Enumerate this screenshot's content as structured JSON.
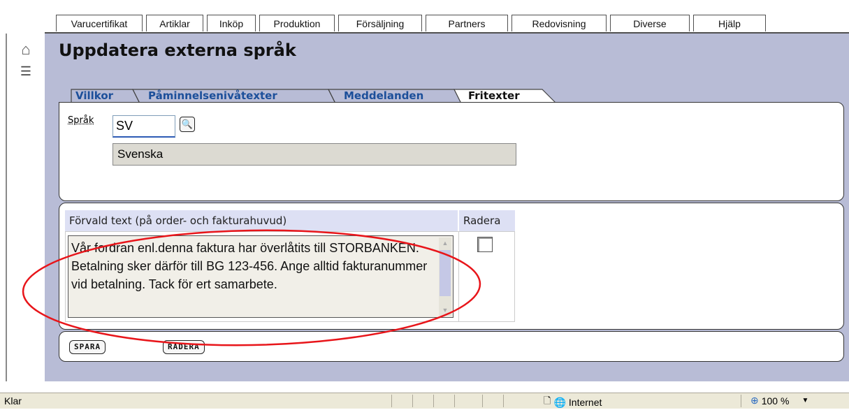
{
  "menu": {
    "items": [
      "Varucertifikat",
      "Artiklar",
      "Inköp",
      "Produktion",
      "Försäljning",
      "Partners",
      "Redovisning",
      "Diverse",
      "Hjälp"
    ]
  },
  "sidebar": {
    "home_icon": "home-icon",
    "list_icon": "list-icon"
  },
  "page": {
    "title": "Uppdatera externa språk"
  },
  "tabs": [
    "Villkor",
    "Påminnelsenivåtexter",
    "Meddelanden",
    "Fritexter"
  ],
  "language": {
    "label": "Språk",
    "code": "SV",
    "name": "Svenska"
  },
  "table": {
    "col_text": "Förvald text (på order- och fakturahuvud)",
    "col_delete": "Radera",
    "text_value": "Vår fordran enl.denna faktura har överlåtits till STORBANKEN. Betalning sker därför till BG 123-456. Ange alltid fakturanummer vid betalning. Tack för ert samarbete.",
    "delete_checked": false
  },
  "buttons": {
    "save": "SPARA",
    "delete": "RADERA"
  },
  "status": {
    "text": "Klar",
    "zone": "Internet",
    "zoom": "100 %"
  },
  "colors": {
    "background": "#b8bcd6",
    "annotation": "#e8151a",
    "tab_link": "#1c4f9a"
  }
}
